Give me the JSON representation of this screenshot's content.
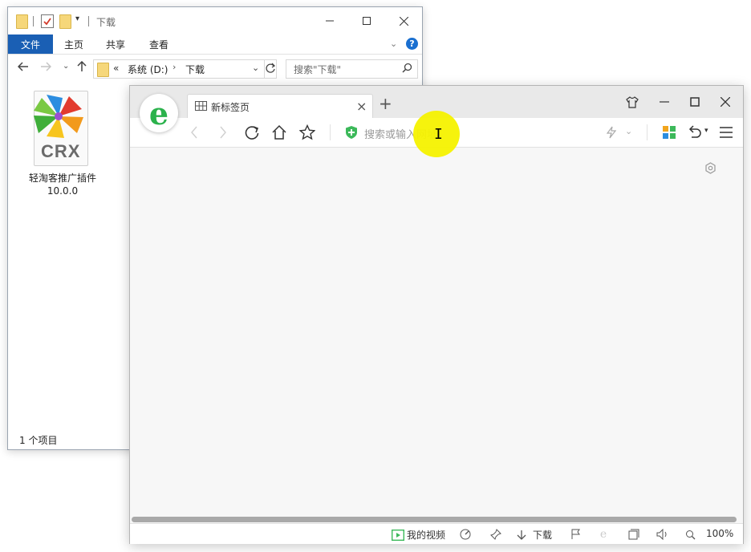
{
  "explorer": {
    "title": "下载",
    "ribbon_tabs": [
      "文件",
      "主页",
      "共享",
      "查看"
    ],
    "address": {
      "prefix": "«",
      "segments": [
        "系统 (D:)",
        "下载"
      ]
    },
    "search_placeholder": "搜索\"下载\"",
    "files": [
      {
        "name": "轻淘客推广插件",
        "version": "10.0.0",
        "badge": "CRX"
      }
    ],
    "status": "1 个项目"
  },
  "browser": {
    "tab_title": "新标签页",
    "url_placeholder": "搜索或输入网址",
    "status_bar": {
      "video_label": "我的视频",
      "download_label": "下载",
      "zoom": "100%"
    },
    "colors": {
      "logo_green": "#2bb24c",
      "shield_green": "#3cb95a",
      "cursor_highlight": "#f5f200"
    }
  }
}
